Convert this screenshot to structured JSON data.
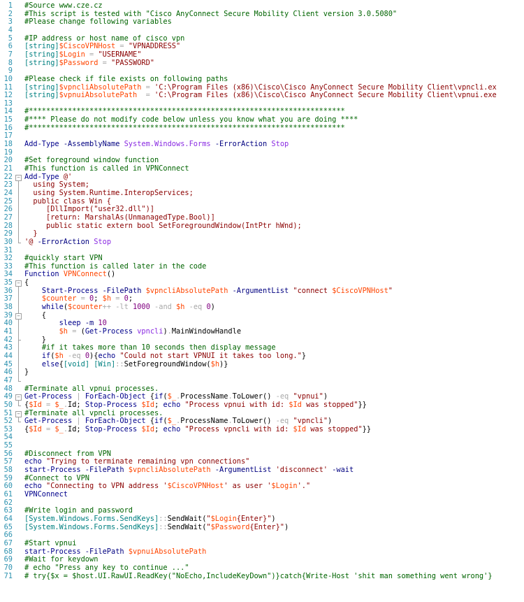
{
  "editor": {
    "lines": [
      [
        [
          "c",
          "#Source www.cze.cz"
        ]
      ],
      [
        [
          "c",
          "#This script is tested with \"Cisco AnyConnect Secure Mobility Client version 3.0.5080\""
        ]
      ],
      [
        [
          "c",
          "#Please change following variables"
        ]
      ],
      [],
      [
        [
          "c",
          "#IP address or host name of cisco vpn"
        ]
      ],
      [
        [
          "t",
          "[string]"
        ],
        [
          "v",
          "$CiscoVPNHost"
        ],
        [
          "o",
          " = "
        ],
        [
          "s",
          "\"VPNADDRESS\""
        ]
      ],
      [
        [
          "t",
          "[string]"
        ],
        [
          "v",
          "$Login"
        ],
        [
          "o",
          " = "
        ],
        [
          "s",
          "\"USERNAME\""
        ]
      ],
      [
        [
          "t",
          "[string]"
        ],
        [
          "v",
          "$Password"
        ],
        [
          "o",
          " = "
        ],
        [
          "s",
          "\"PASSWORD\""
        ]
      ],
      [],
      [
        [
          "c",
          "#Please check if file exists on following paths"
        ]
      ],
      [
        [
          "t",
          "[string]"
        ],
        [
          "v",
          "$vpncliAbsolutePath"
        ],
        [
          "o",
          " = "
        ],
        [
          "s",
          "'C:\\Program Files (x86)\\Cisco\\Cisco AnyConnect Secure Mobility Client\\vpncli.ex"
        ]
      ],
      [
        [
          "t",
          "[string]"
        ],
        [
          "v",
          "$vpnuiAbsolutePath"
        ],
        [
          "o",
          "  = "
        ],
        [
          "s",
          "'C:\\Program Files (x86)\\Cisco\\Cisco AnyConnect Secure Mobility Client\\vpnui.exe"
        ]
      ],
      [],
      [
        [
          "c",
          "#*************************************************************************"
        ]
      ],
      [
        [
          "c",
          "#**** Please do not modify code below unless you know what you are doing ****"
        ]
      ],
      [
        [
          "c",
          "#*************************************************************************"
        ]
      ],
      [],
      [
        [
          "k",
          "Add-Type"
        ],
        [
          "b",
          " "
        ],
        [
          "p",
          "-AssemblyName"
        ],
        [
          "b",
          " "
        ],
        [
          "a",
          "System.Windows.Forms"
        ],
        [
          "b",
          " "
        ],
        [
          "p",
          "-ErrorAction"
        ],
        [
          "b",
          " "
        ],
        [
          "a",
          "Stop"
        ]
      ],
      [],
      [
        [
          "c",
          "#Set foreground window function"
        ]
      ],
      [
        [
          "c",
          "#This function is called in VPNConnect"
        ]
      ],
      [
        [
          "k",
          "Add-Type"
        ],
        [
          "b",
          " "
        ],
        [
          "s",
          "@'"
        ]
      ],
      [
        [
          "s",
          "  using System;"
        ]
      ],
      [
        [
          "s",
          "  using System.Runtime.InteropServices;"
        ]
      ],
      [
        [
          "s",
          "  public class Win {"
        ]
      ],
      [
        [
          "s",
          "     [DllImport(\"user32.dll\")]"
        ]
      ],
      [
        [
          "s",
          "     [return: MarshalAs(UnmanagedType.Bool)]"
        ]
      ],
      [
        [
          "s",
          "     public static extern bool SetForegroundWindow(IntPtr hWnd);"
        ]
      ],
      [
        [
          "s",
          "  }"
        ]
      ],
      [
        [
          "s",
          "'@"
        ],
        [
          "b",
          " "
        ],
        [
          "p",
          "-ErrorAction"
        ],
        [
          "b",
          " "
        ],
        [
          "a",
          "Stop"
        ]
      ],
      [],
      [
        [
          "c",
          "#quickly start VPN"
        ]
      ],
      [
        [
          "c",
          "#This function is called later in the code"
        ]
      ],
      [
        [
          "w",
          "Function"
        ],
        [
          "b",
          " "
        ],
        [
          "f",
          "VPNConnect"
        ],
        [
          "b",
          "()"
        ]
      ],
      [
        [
          "b",
          "{"
        ]
      ],
      [
        [
          "b",
          "    "
        ],
        [
          "k",
          "Start-Process"
        ],
        [
          "b",
          " "
        ],
        [
          "p",
          "-FilePath"
        ],
        [
          "b",
          " "
        ],
        [
          "v",
          "$vpncliAbsolutePath"
        ],
        [
          "b",
          " "
        ],
        [
          "p",
          "-ArgumentList"
        ],
        [
          "b",
          " "
        ],
        [
          "s",
          "\"connect "
        ],
        [
          "v",
          "$CiscoVPNHost"
        ],
        [
          "s",
          "\""
        ]
      ],
      [
        [
          "b",
          "    "
        ],
        [
          "v",
          "$counter"
        ],
        [
          "o",
          " = "
        ],
        [
          "n",
          "0"
        ],
        [
          "b",
          "; "
        ],
        [
          "v",
          "$h"
        ],
        [
          "o",
          " = "
        ],
        [
          "n",
          "0"
        ],
        [
          "b",
          ";"
        ]
      ],
      [
        [
          "b",
          "    "
        ],
        [
          "w",
          "while"
        ],
        [
          "b",
          "("
        ],
        [
          "v",
          "$counter"
        ],
        [
          "o",
          "++ -lt "
        ],
        [
          "n",
          "1000"
        ],
        [
          "o",
          " -and "
        ],
        [
          "v",
          "$h"
        ],
        [
          "o",
          " -eq "
        ],
        [
          "n",
          "0"
        ],
        [
          "b",
          ")"
        ]
      ],
      [
        [
          "b",
          "    {"
        ]
      ],
      [
        [
          "b",
          "        "
        ],
        [
          "k",
          "sleep"
        ],
        [
          "b",
          " "
        ],
        [
          "p",
          "-m"
        ],
        [
          "b",
          " "
        ],
        [
          "n",
          "10"
        ]
      ],
      [
        [
          "b",
          "        "
        ],
        [
          "v",
          "$h"
        ],
        [
          "o",
          " = "
        ],
        [
          "b",
          "("
        ],
        [
          "k",
          "Get-Process"
        ],
        [
          "b",
          " "
        ],
        [
          "a",
          "vpncli"
        ],
        [
          "b",
          ")"
        ],
        [
          "o",
          "."
        ],
        [
          "b",
          "MainWindowHandle"
        ]
      ],
      [
        [
          "b",
          "    }"
        ]
      ],
      [
        [
          "b",
          "    "
        ],
        [
          "c",
          "#if it takes more than 10 seconds then display message"
        ]
      ],
      [
        [
          "b",
          "    "
        ],
        [
          "w",
          "if"
        ],
        [
          "b",
          "("
        ],
        [
          "v",
          "$h"
        ],
        [
          "o",
          " -eq "
        ],
        [
          "n",
          "0"
        ],
        [
          "b",
          "){"
        ],
        [
          "k",
          "echo"
        ],
        [
          "b",
          " "
        ],
        [
          "s",
          "\"Could not start VPNUI it takes too long.\""
        ],
        [
          "b",
          "}"
        ]
      ],
      [
        [
          "b",
          "    "
        ],
        [
          "w",
          "else"
        ],
        [
          "b",
          "{"
        ],
        [
          "t",
          "[void]"
        ],
        [
          "b",
          " "
        ],
        [
          "t",
          "[Win]"
        ],
        [
          "o",
          "::"
        ],
        [
          "b",
          "SetForegroundWindow("
        ],
        [
          "v",
          "$h"
        ],
        [
          "b",
          ")}"
        ]
      ],
      [
        [
          "b",
          "}"
        ]
      ],
      [],
      [
        [
          "c",
          "#Terminate all vpnui processes."
        ]
      ],
      [
        [
          "k",
          "Get-Process"
        ],
        [
          "o",
          " | "
        ],
        [
          "k",
          "ForEach-Object"
        ],
        [
          "b",
          " {"
        ],
        [
          "w",
          "if"
        ],
        [
          "b",
          "("
        ],
        [
          "v",
          "$_"
        ],
        [
          "o",
          "."
        ],
        [
          "b",
          "ProcessName"
        ],
        [
          "o",
          "."
        ],
        [
          "b",
          "ToLower()"
        ],
        [
          "o",
          " -eq "
        ],
        [
          "s",
          "\"vpnui\""
        ],
        [
          "b",
          ")"
        ]
      ],
      [
        [
          "b",
          "{"
        ],
        [
          "v",
          "$Id"
        ],
        [
          "o",
          " = "
        ],
        [
          "v",
          "$_"
        ],
        [
          "o",
          "."
        ],
        [
          "b",
          "Id; "
        ],
        [
          "k",
          "Stop-Process"
        ],
        [
          "b",
          " "
        ],
        [
          "v",
          "$Id"
        ],
        [
          "b",
          "; "
        ],
        [
          "k",
          "echo"
        ],
        [
          "b",
          " "
        ],
        [
          "s",
          "\"Process vpnui with id: "
        ],
        [
          "v",
          "$Id"
        ],
        [
          "s",
          " was stopped\""
        ],
        [
          "b",
          "}}"
        ]
      ],
      [
        [
          "c",
          "#Terminate all vpncli processes."
        ]
      ],
      [
        [
          "k",
          "Get-Process"
        ],
        [
          "o",
          " | "
        ],
        [
          "k",
          "ForEach-Object"
        ],
        [
          "b",
          " {"
        ],
        [
          "w",
          "if"
        ],
        [
          "b",
          "("
        ],
        [
          "v",
          "$_"
        ],
        [
          "o",
          "."
        ],
        [
          "b",
          "ProcessName"
        ],
        [
          "o",
          "."
        ],
        [
          "b",
          "ToLower()"
        ],
        [
          "o",
          " -eq "
        ],
        [
          "s",
          "\"vpncli\""
        ],
        [
          "b",
          ")"
        ]
      ],
      [
        [
          "b",
          "{"
        ],
        [
          "v",
          "$Id"
        ],
        [
          "o",
          " = "
        ],
        [
          "v",
          "$_"
        ],
        [
          "o",
          "."
        ],
        [
          "b",
          "Id; "
        ],
        [
          "k",
          "Stop-Process"
        ],
        [
          "b",
          " "
        ],
        [
          "v",
          "$Id"
        ],
        [
          "b",
          "; "
        ],
        [
          "k",
          "echo"
        ],
        [
          "b",
          " "
        ],
        [
          "s",
          "\"Process vpncli with id: "
        ],
        [
          "v",
          "$Id"
        ],
        [
          "s",
          " was stopped\""
        ],
        [
          "b",
          "}}"
        ]
      ],
      [],
      [],
      [
        [
          "c",
          "#Disconnect from VPN"
        ]
      ],
      [
        [
          "k",
          "echo"
        ],
        [
          "b",
          " "
        ],
        [
          "s",
          "\"Trying to terminate remaining vpn connections\""
        ]
      ],
      [
        [
          "k",
          "start-Process"
        ],
        [
          "b",
          " "
        ],
        [
          "p",
          "-FilePath"
        ],
        [
          "b",
          " "
        ],
        [
          "v",
          "$vpncliAbsolutePath"
        ],
        [
          "b",
          " "
        ],
        [
          "p",
          "-ArgumentList"
        ],
        [
          "b",
          " "
        ],
        [
          "s",
          "'disconnect'"
        ],
        [
          "b",
          " "
        ],
        [
          "p",
          "-wait"
        ]
      ],
      [
        [
          "c",
          "#Connect to VPN"
        ]
      ],
      [
        [
          "k",
          "echo"
        ],
        [
          "b",
          " "
        ],
        [
          "s",
          "\"Connecting to VPN address '"
        ],
        [
          "v",
          "$CiscoVPNHost"
        ],
        [
          "s",
          "' as user '"
        ],
        [
          "v",
          "$Login"
        ],
        [
          "s",
          "'.\""
        ]
      ],
      [
        [
          "k",
          "VPNConnect"
        ]
      ],
      [],
      [
        [
          "c",
          "#Write login and password"
        ]
      ],
      [
        [
          "t",
          "[System.Windows.Forms.SendKeys]"
        ],
        [
          "o",
          "::"
        ],
        [
          "b",
          "SendWait("
        ],
        [
          "s",
          "\""
        ],
        [
          "v",
          "$Login"
        ],
        [
          "s",
          "{Enter}\""
        ],
        [
          "b",
          ")"
        ]
      ],
      [
        [
          "t",
          "[System.Windows.Forms.SendKeys]"
        ],
        [
          "o",
          "::"
        ],
        [
          "b",
          "SendWait("
        ],
        [
          "s",
          "\""
        ],
        [
          "v",
          "$Password"
        ],
        [
          "s",
          "{Enter}\""
        ],
        [
          "b",
          ")"
        ]
      ],
      [],
      [
        [
          "c",
          "#Start vpnui"
        ]
      ],
      [
        [
          "k",
          "start-Process"
        ],
        [
          "b",
          " "
        ],
        [
          "p",
          "-FilePath"
        ],
        [
          "b",
          " "
        ],
        [
          "v",
          "$vpnuiAbsolutePath"
        ]
      ],
      [
        [
          "c",
          "#Wait for keydown"
        ]
      ],
      [
        [
          "c",
          "# echo \"Press any key to continue ...\""
        ]
      ],
      [
        [
          "c",
          "# try{$x = $host.UI.RawUI.ReadKey(\"NoEcho,IncludeKeyDown\")}catch{Write-Host 'shit man something went wrong'}"
        ]
      ]
    ],
    "colors": {
      "background": "#ffffff",
      "line_numbers": "#2b91af",
      "comment": "#006400",
      "command": "#00008b",
      "variable": "#ff4500",
      "string": "#8b0000",
      "type": "#008080",
      "keyword": "#00008b",
      "number": "#800080",
      "parameter": "#000080",
      "operator": "#a9a9a9",
      "argument": "#8a2be2"
    }
  }
}
